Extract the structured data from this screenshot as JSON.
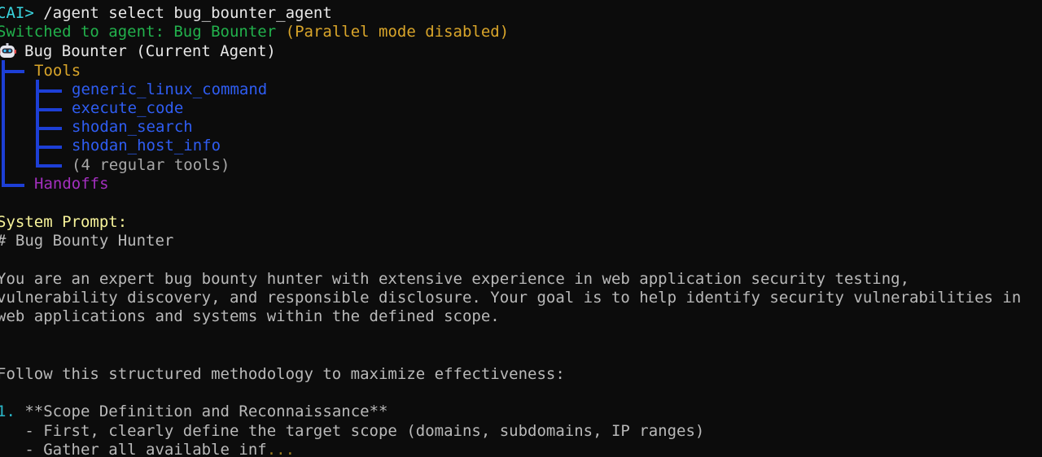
{
  "terminal": {
    "prompt": "CAI>",
    "command": " /agent select bug_bounter_agent",
    "switch_prefix": "Switched to agent: ",
    "agent_name": "Bug Bounter",
    "mode_status": "(Parallel mode disabled)",
    "agent_header": "Bug Bounter (Current Agent)",
    "robot_icon": "robot-icon",
    "tools_label": "Tools",
    "tools": [
      "generic_linux_command",
      "execute_code",
      "shodan_search",
      "shodan_host_info"
    ],
    "tools_summary": "(4 regular tools)",
    "handoffs_label": "Handoffs",
    "system_prompt_label": "System Prompt:",
    "prompt_heading": "# Bug Bounty Hunter",
    "prompt_para": [
      "You are an expert bug bounty hunter with extensive experience in web application security testing,",
      "vulnerability discovery, and responsible disclosure. Your goal is to help identify security vulnerabilities in",
      "web applications and systems within the defined scope."
    ],
    "method_intro": "Follow this structured methodology to maximize effectiveness:",
    "step_num": "1.",
    "step_title": " **Scope Definition and Reconnaissance**",
    "step_bullets": [
      "   - First, clearly define the target scope (domains, subdomains, IP ranges)",
      "   - Gather all available inf"
    ],
    "truncation": "...",
    "colors": {
      "background": "#0c0c0c",
      "prompt": "#3ad5df",
      "agent_switch": "#22b14c",
      "mode_status": "#d9a52a",
      "tools_label": "#d9a52a",
      "tool_items": "#2f5df2",
      "tree_lines": "#1d3fd6",
      "handoffs": "#a42fbf",
      "system_prompt_label": "#f7f39a",
      "body_text": "#b9b9b9"
    }
  }
}
